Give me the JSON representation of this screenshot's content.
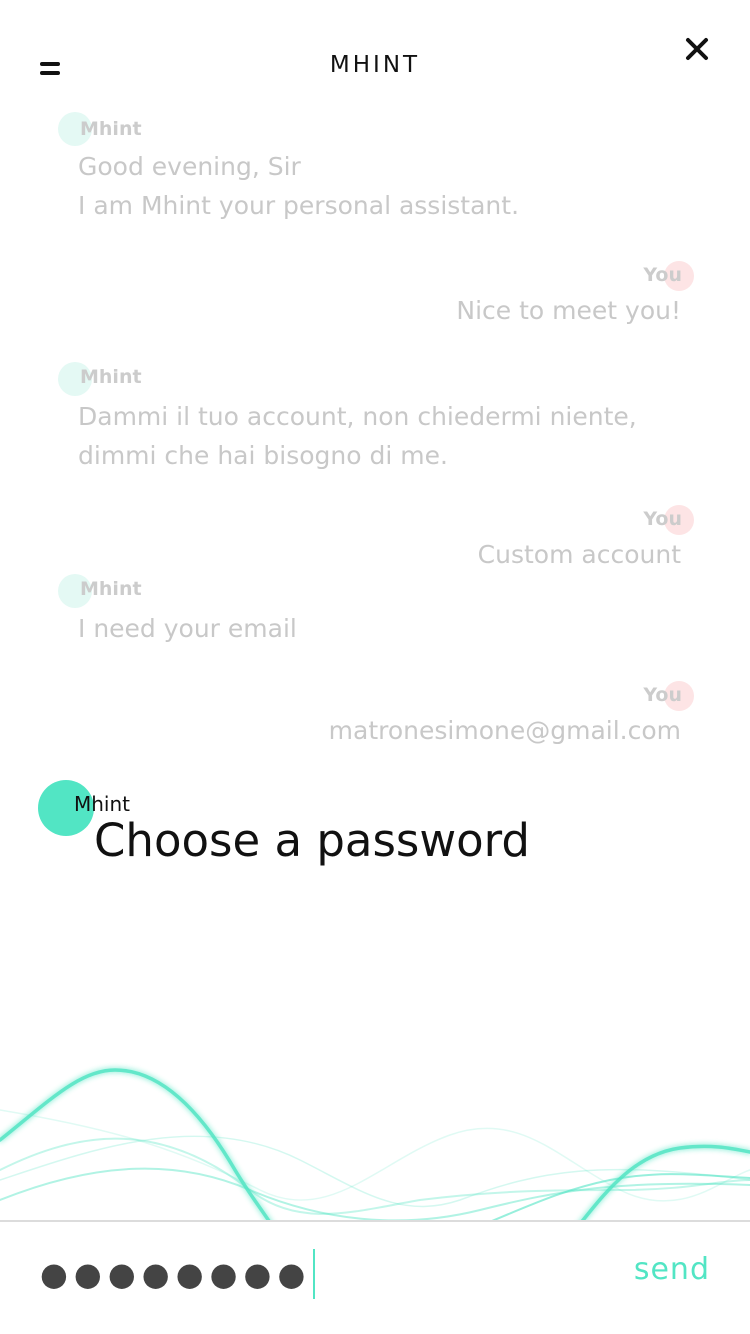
{
  "header": {
    "title": "MHINT",
    "menu_icon": "menu-icon",
    "close_icon": "close-icon"
  },
  "conversation": [
    {
      "from": "bot",
      "sender": "Mhint",
      "lines": [
        "Good evening, Sir",
        "I am Mhint your personal assistant."
      ]
    },
    {
      "from": "user",
      "sender": "You",
      "lines": [
        "Nice to meet you!"
      ]
    },
    {
      "from": "bot",
      "sender": "Mhint",
      "lines": [
        "Dammi il tuo account, non chiedermi niente,",
        "dimmi che hai bisogno di me."
      ]
    },
    {
      "from": "user",
      "sender": "You",
      "lines": [
        "Custom account"
      ]
    },
    {
      "from": "bot",
      "sender": "Mhint",
      "lines": [
        "I need your email"
      ]
    },
    {
      "from": "user",
      "sender": "You",
      "lines": [
        "matronesimone@gmail.com"
      ]
    }
  ],
  "active_message": {
    "sender": "Mhint",
    "text": "Choose a password"
  },
  "input": {
    "masked_value": "●●●●●●●●",
    "send_label": "send"
  },
  "colors": {
    "accent": "#52e5c4",
    "bot_dot": "#e4f9f4",
    "user_dot": "#fde4e5",
    "faded_text": "#c8c8c8",
    "primary_text": "#111111"
  }
}
